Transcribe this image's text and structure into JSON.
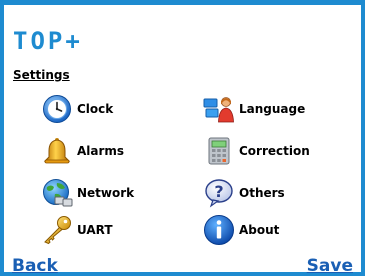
{
  "app": {
    "title": "TOP+"
  },
  "screen": {
    "heading": "Settings"
  },
  "menu": [
    {
      "label": "Clock",
      "icon": "clock-icon"
    },
    {
      "label": "Language",
      "icon": "language-icon"
    },
    {
      "label": "Alarms",
      "icon": "bell-icon"
    },
    {
      "label": "Correction",
      "icon": "calculator-icon"
    },
    {
      "label": "Network",
      "icon": "network-globe-icon"
    },
    {
      "label": "Others",
      "icon": "question-icon"
    },
    {
      "label": "UART",
      "icon": "key-icon"
    },
    {
      "label": "About",
      "icon": "info-icon"
    }
  ],
  "softkeys": {
    "left": "Back",
    "right": "Save"
  },
  "colors": {
    "accent": "#1e8bd0",
    "link": "#1a5fb4"
  }
}
